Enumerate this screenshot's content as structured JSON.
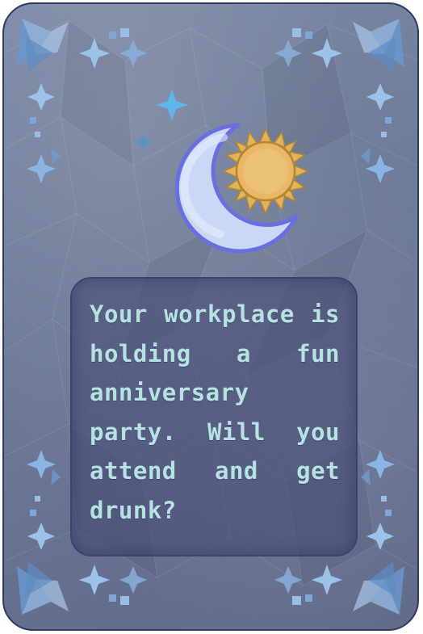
{
  "card": {
    "prompt": "Your workplace is holding a fun anniversary party. Will you attend and get drunk?",
    "emblem": {
      "moon_icon": "crescent-moon-icon",
      "sun_icon": "sun-icon",
      "sparkle_icon": "sparkle-star-icon"
    }
  },
  "colors": {
    "card_background": "#6f7c98",
    "border": "#2c3a66",
    "text": "#b6e3e2",
    "moon": "#c9d8f5",
    "sun": "#e8b866",
    "star_accent": "#5fb6e8"
  }
}
